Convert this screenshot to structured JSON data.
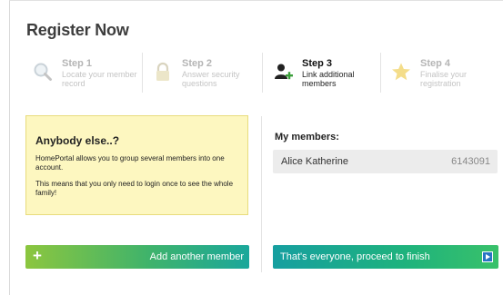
{
  "page": {
    "title": "Register Now"
  },
  "steps": [
    {
      "number": "Step 1",
      "description": "Locate your member record",
      "icon": "magnifier-icon",
      "state": "done"
    },
    {
      "number": "Step 2",
      "description": "Answer security questions",
      "icon": "padlock-icon",
      "state": "done"
    },
    {
      "number": "Step 3",
      "description": "Link additional members",
      "icon": "add-user-icon",
      "state": "active"
    },
    {
      "number": "Step 4",
      "description": "Finalise your registration",
      "icon": "star-icon",
      "state": "pending"
    }
  ],
  "info": {
    "title": "Anybody else..?",
    "paragraph1": "HomePortal allows you to group several members into one account.",
    "paragraph2": "This means that you only need to login once to see the whole family!"
  },
  "members": {
    "title": "My members:",
    "rows": [
      {
        "name": "Alice Katherine",
        "id": "6143091"
      }
    ]
  },
  "buttons": {
    "add_label": "Add another member",
    "finish_label": "That's everyone, proceed to finish"
  },
  "colors": {
    "info_bg": "#fdf7c0",
    "button_green": "#8cc63f",
    "button_teal": "#1aa79b",
    "play_blue": "#2874c4"
  }
}
